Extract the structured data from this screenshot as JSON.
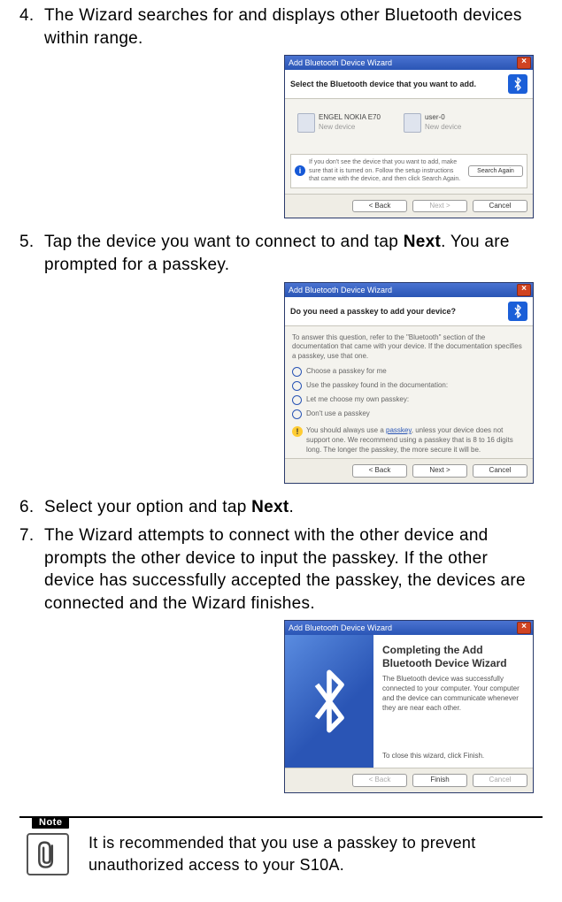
{
  "steps": {
    "s4": {
      "num": "4.",
      "text": "The Wizard searches for and displays other Bluetooth devices within range."
    },
    "s5a": {
      "num": "5.",
      "text_pre": "Tap the device you want to connect to and tap ",
      "bold": "Next",
      "text_post": ". You are prompted for a passkey."
    },
    "s6": {
      "num": "6.",
      "text_pre": "Select your option and tap ",
      "bold": "Next",
      "text_post": "."
    },
    "s7": {
      "num": "7.",
      "text": "The Wizard attempts to connect with the other device and prompts the other device to input the passkey. If the other device has successfully accepted the passkey, the devices are connected and the Wizard finishes."
    }
  },
  "dlg1": {
    "title": "Add Bluetooth Device Wizard",
    "heading": "Select the Bluetooth device that you want to add.",
    "dev1": {
      "name": "ENGEL NOKIA E70",
      "sub": "New device"
    },
    "dev2": {
      "name": "user-0",
      "sub": "New device"
    },
    "info": "If you don't see the device that you want to add, make sure that it is turned on. Follow the setup instructions that came with the device, and then click Search Again.",
    "search": "Search Again",
    "back": "< Back",
    "next": "Next >",
    "cancel": "Cancel"
  },
  "dlg2": {
    "title": "Add Bluetooth Device Wizard",
    "heading": "Do you need a passkey to add your device?",
    "intro": "To answer this question, refer to the \"Bluetooth\" section of the documentation that came with your device. If the documentation specifies a passkey, use that one.",
    "opt1": "Choose a passkey for me",
    "opt2": "Use the passkey found in the documentation:",
    "opt3": "Let me choose my own passkey:",
    "opt4": "Don't use a passkey",
    "warn_pre": "You should always use a ",
    "warn_link": "passkey",
    "warn_post": ", unless your device does not support one. We recommend using a passkey that is 8 to 16 digits long. The longer the passkey, the more secure it will be.",
    "back": "< Back",
    "next": "Next >",
    "cancel": "Cancel"
  },
  "dlg3": {
    "title": "Add Bluetooth Device Wizard",
    "heading": "Completing the Add Bluetooth Device Wizard",
    "body": "The Bluetooth device was successfully connected to your computer. Your computer and the device can communicate whenever they are near each other.",
    "finish_hint": "To close this wizard, click Finish.",
    "back": "< Back",
    "finish": "Finish",
    "cancel": "Cancel"
  },
  "note": {
    "label": "Note",
    "text": "It is recommended that you use a passkey to prevent unauthorized access to your S10A."
  }
}
